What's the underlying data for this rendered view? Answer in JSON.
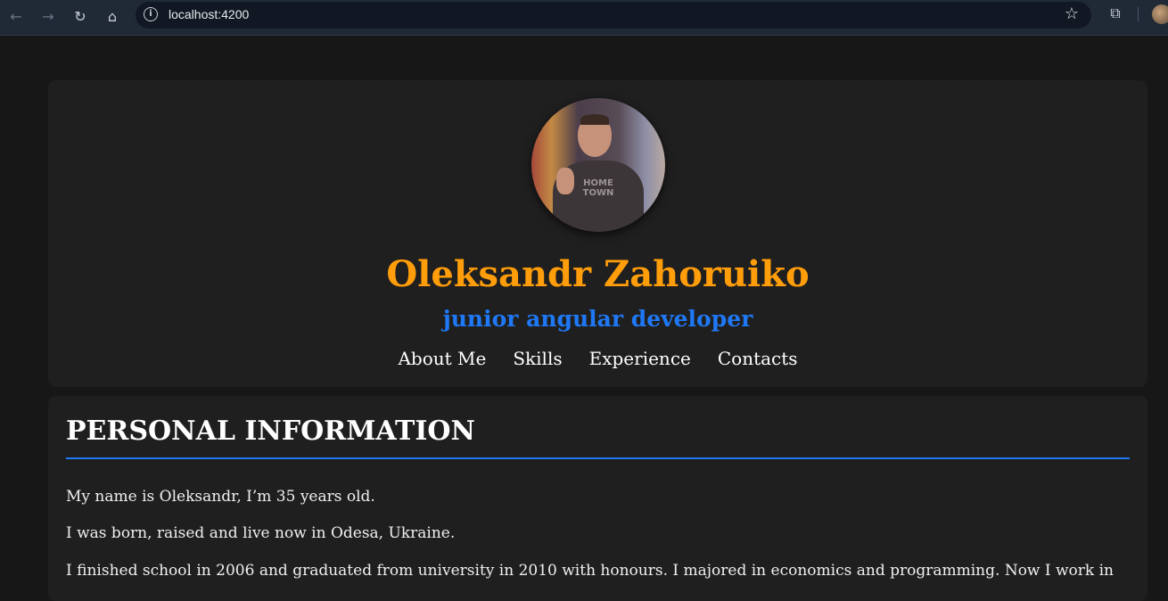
{
  "browser": {
    "url": "localhost:4200",
    "back_icon": "←",
    "forward_icon": "→",
    "reload_icon": "↻",
    "home_icon": "⌂",
    "info_icon": "i",
    "star_icon": "☆",
    "extensions_icon": "⧉"
  },
  "header": {
    "name": "Oleksandr Zahoruiko",
    "role": "junior angular developer",
    "avatar_shirt_text": "HOME TOWN",
    "nav": [
      "About Me",
      "Skills",
      "Experience",
      "Contacts"
    ]
  },
  "personal_info": {
    "title": "PERSONAL INFORMATION",
    "paragraphs": [
      "My name is Oleksandr, I’m 35 years old.",
      "I was born, raised and live now in Odesa, Ukraine.",
      "I finished school in 2006 and graduated from university in 2010 with honours. I majored in economics and programming. Now I work in"
    ]
  },
  "colors": {
    "name": "#ff9d0a",
    "role": "#1f78f5",
    "accent_line": "#1f78f5",
    "card_bg": "#1f1f1f",
    "page_bg": "#171717"
  }
}
